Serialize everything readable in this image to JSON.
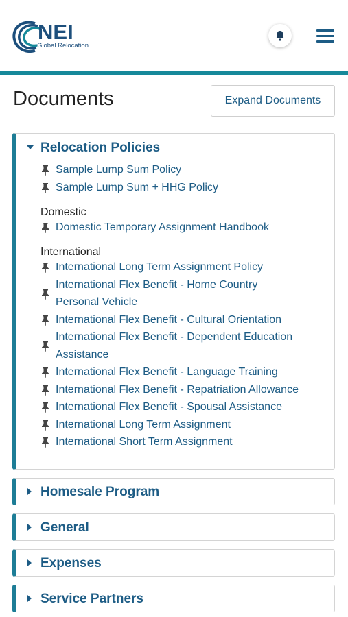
{
  "header": {
    "logo_text": "NEI",
    "logo_subtitle": "Global Relocation",
    "bell_icon": "bell-icon",
    "menu_icon": "hamburger-menu-icon",
    "accent_color": "#16899a"
  },
  "page": {
    "title": "Documents",
    "expand_button_label": "Expand Documents"
  },
  "sections": {
    "relocation_policies": {
      "title": "Relocation Policies",
      "expanded": true,
      "items": [
        "Sample Lump Sum Policy",
        "Sample Lump Sum + HHG Policy"
      ],
      "domestic": {
        "label": "Domestic",
        "items": [
          "Domestic Temporary Assignment Handbook"
        ]
      },
      "international": {
        "label": "International",
        "items": [
          "International Long Term Assignment Policy",
          "International Flex Benefit - Home Country Personal Vehicle",
          "International Flex Benefit - Cultural Orientation",
          "International Flex Benefit - Dependent Education Assistance",
          "International Flex Benefit - Language Training",
          "International Flex Benefit - Repatriation Allowance",
          "International Flex Benefit - Spousal Assistance",
          "International Long Term Assignment",
          "International Short Term Assignment"
        ]
      }
    },
    "homesale": {
      "title": "Homesale Program",
      "expanded": false
    },
    "general": {
      "title": "General",
      "expanded": false
    },
    "expenses": {
      "title": "Expenses",
      "expanded": false
    },
    "service_partners": {
      "title": "Service Partners",
      "expanded": false
    }
  },
  "colors": {
    "link": "#1d5c85",
    "panel_accent": "#1d7d96"
  }
}
